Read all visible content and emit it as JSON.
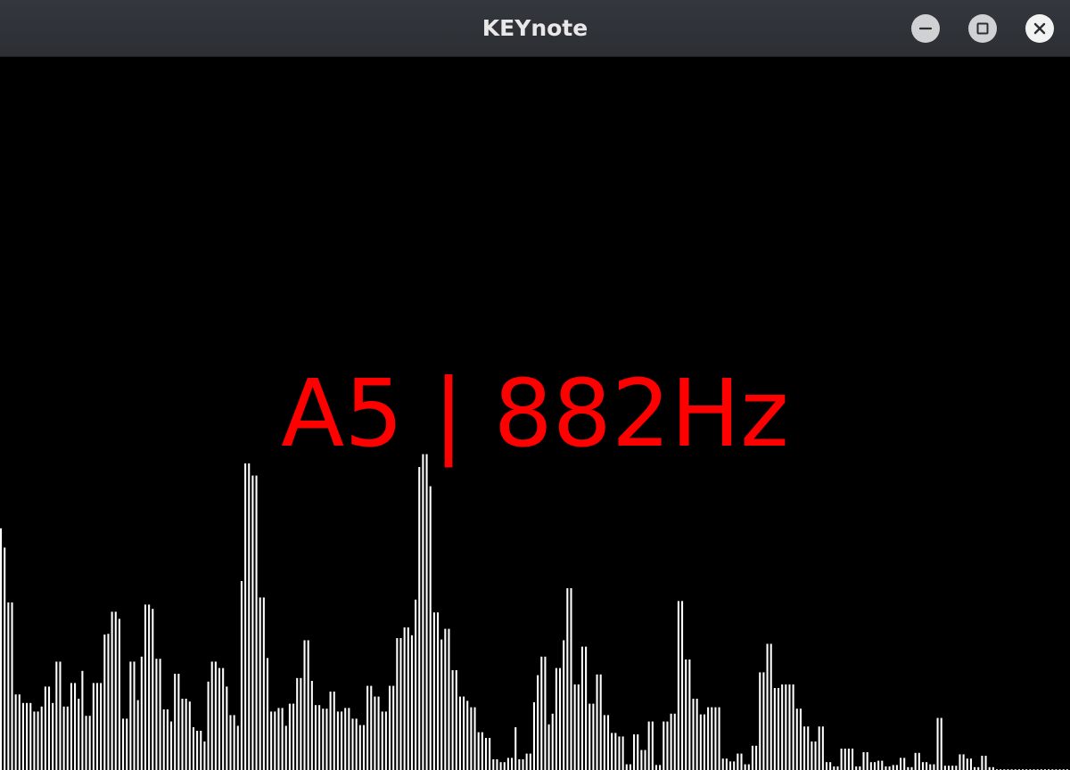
{
  "window": {
    "title": "KEYnote",
    "buttons": {
      "minimize_icon": "minimize-icon",
      "maximize_icon": "maximize-icon",
      "close_icon": "close-icon"
    }
  },
  "display": {
    "note_text": "A5 | 882Hz",
    "note_color": "#ff0000"
  },
  "spectrum": {
    "bar_color": "#ffffff",
    "background_color": "#000000",
    "levels": [
      0.339,
      0.312,
      0.235,
      0.235,
      0.106,
      0.106,
      0.094,
      0.094,
      0.094,
      0.082,
      0.082,
      0.089,
      0.117,
      0.117,
      0.094,
      0.152,
      0.152,
      0.089,
      0.089,
      0.122,
      0.122,
      0.1,
      0.139,
      0.076,
      0.076,
      0.122,
      0.122,
      0.122,
      0.19,
      0.191,
      0.222,
      0.222,
      0.212,
      0.072,
      0.072,
      0.152,
      0.152,
      0.098,
      0.159,
      0.232,
      0.232,
      0.226,
      0.156,
      0.156,
      0.085,
      0.085,
      0.068,
      0.135,
      0.135,
      0.1,
      0.1,
      0.096,
      0.06,
      0.055,
      0.055,
      0.04,
      0.124,
      0.152,
      0.152,
      0.143,
      0.143,
      0.117,
      0.077,
      0.077,
      0.062,
      0.265,
      0.43,
      0.43,
      0.413,
      0.413,
      0.242,
      0.242,
      0.157,
      0.082,
      0.082,
      0.087,
      0.087,
      0.062,
      0.093,
      0.093,
      0.129,
      0.129,
      0.182,
      0.182,
      0.125,
      0.091,
      0.091,
      0.086,
      0.086,
      0.11,
      0.11,
      0.082,
      0.082,
      0.087,
      0.087,
      0.072,
      0.072,
      0.063,
      0.063,
      0.118,
      0.118,
      0.103,
      0.103,
      0.082,
      0.082,
      0.118,
      0.118,
      0.185,
      0.185,
      0.2,
      0.2,
      0.189,
      0.239,
      0.425,
      0.443,
      0.443,
      0.398,
      0.221,
      0.221,
      0.183,
      0.198,
      0.198,
      0.14,
      0.14,
      0.103,
      0.103,
      0.097,
      0.088,
      0.088,
      0.053,
      0.053,
      0.045,
      0.045,
      0.015,
      0.015,
      0.011,
      0.011,
      0.017,
      0.017,
      0.06,
      0.015,
      0.015,
      0.023,
      0.023,
      0.095,
      0.133,
      0.159,
      0.159,
      0.064,
      0.079,
      0.143,
      0.143,
      0.182,
      0.255,
      0.255,
      0.12,
      0.12,
      0.173,
      0.173,
      0.093,
      0.093,
      0.134,
      0.134,
      0.077,
      0.077,
      0.052,
      0.052,
      0.047,
      0.047,
      0.008,
      0.008,
      0.05,
      0.05,
      0.028,
      0.028,
      0.068,
      0.068,
      0.007,
      0.007,
      0.068,
      0.068,
      0.079,
      0.079,
      0.237,
      0.237,
      0.155,
      0.155,
      0.1,
      0.1,
      0.078,
      0.078,
      0.088,
      0.088,
      0.088,
      0.088,
      0.016,
      0.016,
      0.012,
      0.012,
      0.023,
      0.023,
      0.008,
      0.008,
      0.034,
      0.034,
      0.137,
      0.137,
      0.177,
      0.177,
      0.115,
      0.115,
      0.12,
      0.12,
      0.12,
      0.12,
      0.086,
      0.086,
      0.061,
      0.061,
      0.04,
      0.04,
      0.061,
      0.061,
      0.011,
      0.011,
      0.005,
      0.005,
      0.03,
      0.03,
      0.03,
      0.03,
      0.005,
      0.005,
      0.025,
      0.025,
      0.011,
      0.011,
      0.013,
      0.013,
      0.005,
      0.005,
      0.007,
      0.007,
      0.017,
      0.017,
      0.004,
      0.004,
      0.024,
      0.024,
      0.011,
      0.011,
      0.008,
      0.008,
      0.073,
      0.073,
      0.006,
      0.006,
      0.006,
      0.006,
      0.022,
      0.022,
      0.016,
      0.016,
      0.004,
      0.004,
      0.02,
      0.02,
      0.004,
      0.004,
      0.001,
      0.001,
      0.001,
      0.001,
      0.001,
      0.001,
      0.001,
      0.001,
      0.001,
      0.001,
      0.001,
      0.001,
      0.001,
      0.001,
      0.001,
      0.001,
      0.001,
      0.001,
      0.001,
      0.001
    ]
  }
}
